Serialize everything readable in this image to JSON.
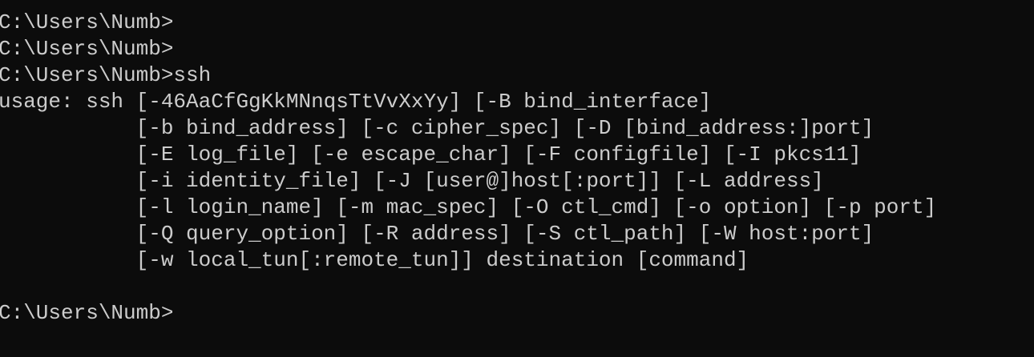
{
  "terminal": {
    "lines": [
      "C:\\Users\\Numb>",
      "C:\\Users\\Numb>",
      "C:\\Users\\Numb>ssh",
      "usage: ssh [-46AaCfGgKkMNnqsTtVvXxYy] [-B bind_interface]",
      "           [-b bind_address] [-c cipher_spec] [-D [bind_address:]port]",
      "           [-E log_file] [-e escape_char] [-F configfile] [-I pkcs11]",
      "           [-i identity_file] [-J [user@]host[:port]] [-L address]",
      "           [-l login_name] [-m mac_spec] [-O ctl_cmd] [-o option] [-p port]",
      "           [-Q query_option] [-R address] [-S ctl_path] [-W host:port]",
      "           [-w local_tun[:remote_tun]] destination [command]",
      "",
      "C:\\Users\\Numb>"
    ]
  }
}
